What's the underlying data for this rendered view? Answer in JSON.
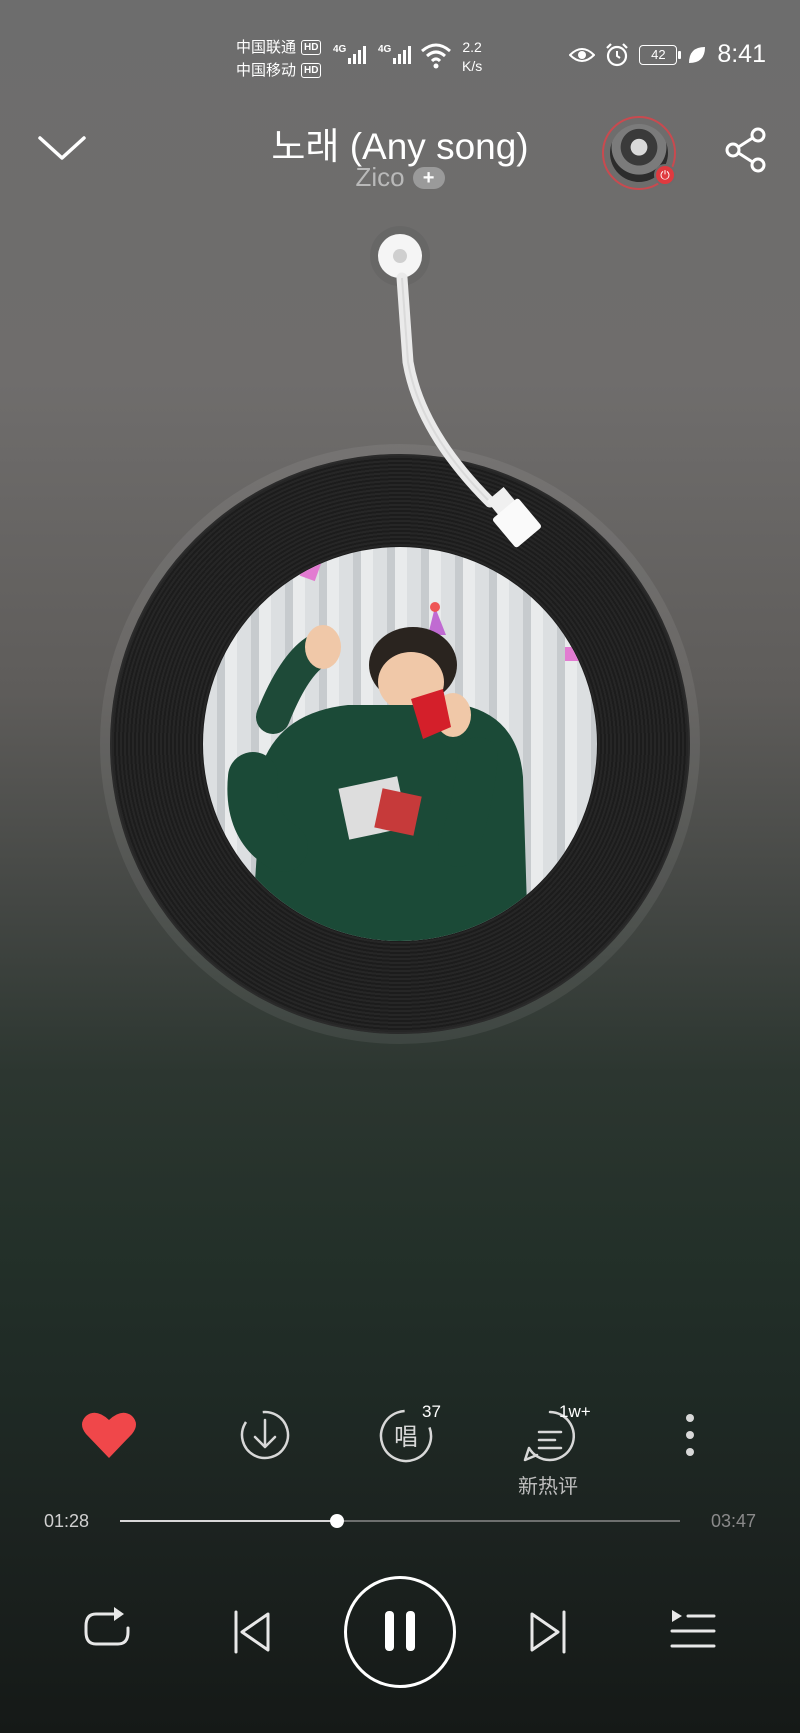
{
  "status_bar": {
    "carrier1": "中国联通",
    "carrier2": "中国移动",
    "hd": "HD",
    "net1": "4G",
    "net2": "4G",
    "speed_value": "2.2",
    "speed_unit": "K/s",
    "battery": "42",
    "time": "8:41"
  },
  "header": {
    "title": "노래 (Any song)",
    "artist": "Zico",
    "follow_symbol": "+"
  },
  "actions": {
    "sing_count": "37",
    "comment_count": "1w+",
    "comment_label": "新热评"
  },
  "progress": {
    "current": "01:28",
    "total": "03:47",
    "fraction": 0.388
  },
  "colors": {
    "like": "#f0474a",
    "avatar_ring": "#c94a4f"
  },
  "icons": {
    "back": "chevron-down-icon",
    "share": "share-icon",
    "like": "heart-icon",
    "download": "download-icon",
    "sing": "sing-icon",
    "comment": "comment-icon",
    "more": "more-vertical-icon",
    "repeat": "repeat-icon",
    "prev": "previous-icon",
    "pause": "pause-icon",
    "next": "next-icon",
    "playlist": "playlist-icon"
  }
}
